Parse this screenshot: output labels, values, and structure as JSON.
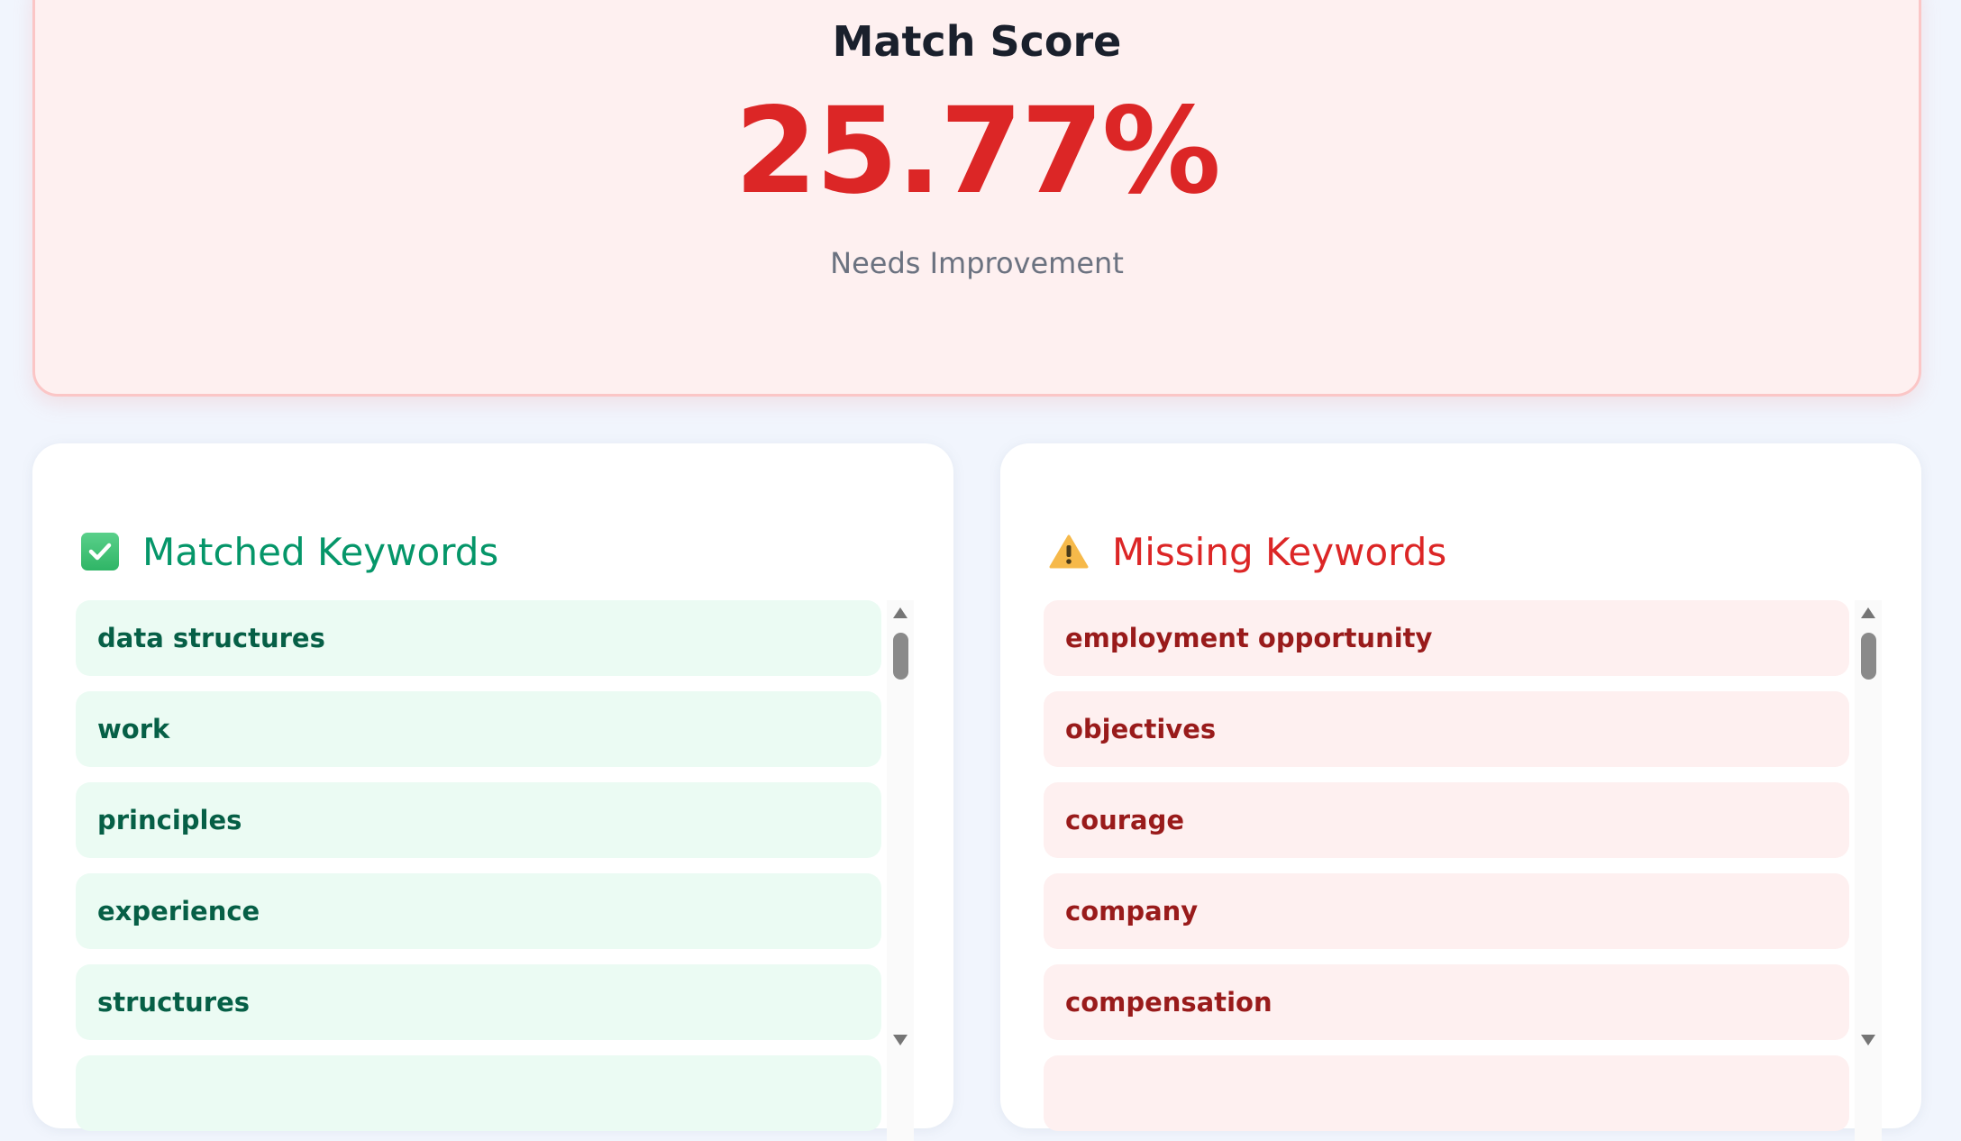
{
  "score": {
    "title": "Match Score",
    "value": "25.77%",
    "status": "Needs Improvement",
    "color": "#dc2626"
  },
  "matched": {
    "title": "Matched Keywords",
    "icon": "check-box-icon",
    "accent": "#059669",
    "items": [
      "data structures",
      "work",
      "principles",
      "experience",
      "structures"
    ]
  },
  "missing": {
    "title": "Missing Keywords",
    "icon": "warning-icon",
    "accent": "#dc2626",
    "items": [
      "employment opportunity",
      "objectives",
      "courage",
      "company",
      "compensation"
    ]
  }
}
